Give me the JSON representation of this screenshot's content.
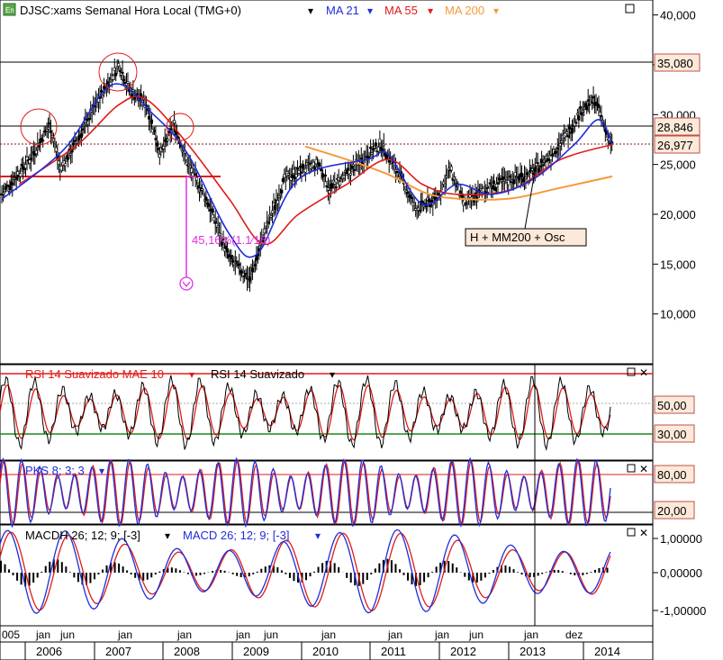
{
  "colors": {
    "ma21": "#1e2dd8",
    "ma55": "#e01b1b",
    "ma200": "#f59a3a",
    "rsi": "#000000",
    "rsi_ma": "#e01b1b",
    "stoch_k": "#1e2dd8",
    "stoch_d": "#e01b1b",
    "macd": "#1e2dd8",
    "macd_signal": "#e01b1b",
    "hist": "#000000",
    "annotation_magenta": "#e22fe2",
    "price_label_bg": "#fde9d9",
    "price_label_border": "#c0504d"
  },
  "header": {
    "icon": "chart-app-icon",
    "title": "DJSC:xams Semanal Hora Local (TMG+0)",
    "ma21": "MA 21",
    "ma55": "MA 55",
    "ma200": "MA 200"
  },
  "annotations": {
    "drop_pct": "45,16%(1.1⁄18)",
    "callout": "H + MM200 + Osc"
  },
  "price_labels": [
    "35,080",
    "28,846",
    "26,977"
  ],
  "rsi_panel": {
    "title_a": "RSI 14 Suavizado MAE 10",
    "title_b": "RSI 14 Suavizado",
    "levels": [
      "50,00",
      "30,00"
    ]
  },
  "stoch_panel": {
    "title": "PKS 8; 3; 3",
    "levels": [
      "80,00",
      "20,00"
    ]
  },
  "macd_panel": {
    "title_a": "MACDH 26; 12; 9; [-3]",
    "title_b": "MACD 26; 12; 9; [-3]"
  },
  "xaxis": {
    "months": [
      "005",
      "jan",
      "jun",
      "jan",
      "jan",
      "jan",
      "jun",
      "jan",
      "jan",
      "jan",
      "jun",
      "jan",
      "dez"
    ],
    "years": [
      "2006",
      "2007",
      "2008",
      "2009",
      "2010",
      "2011",
      "2012",
      "2013",
      "2014"
    ]
  },
  "chart_data": [
    {
      "type": "candlestick-line",
      "title": "DJSC:xams Semanal Hora Local (TMG+0)",
      "x_range": [
        "2005",
        "2014"
      ],
      "ylim": [
        5000,
        41500
      ],
      "yticks": [
        "10,000",
        "15,000",
        "20,000",
        "25,000",
        "30,000",
        "35,000",
        "40,000"
      ],
      "price_path": [
        [
          "2005.6",
          22000
        ],
        [
          "2006.0",
          25500
        ],
        [
          "2006.3",
          29000
        ],
        [
          "2006.45",
          24500
        ],
        [
          "2006.7",
          27500
        ],
        [
          "2007.0",
          31500
        ],
        [
          "2007.3",
          35000
        ],
        [
          "2007.45",
          32500
        ],
        [
          "2007.7",
          31000
        ],
        [
          "2007.9",
          26000
        ],
        [
          "2008.1",
          29000
        ],
        [
          "2008.3",
          25000
        ],
        [
          "2008.6",
          21000
        ],
        [
          "2008.9",
          15500
        ],
        [
          "2009.2",
          13500
        ],
        [
          "2009.4",
          18000
        ],
        [
          "2009.7",
          23500
        ],
        [
          "2009.95",
          24500
        ],
        [
          "2010.2",
          25000
        ],
        [
          "2010.35",
          22500
        ],
        [
          "2010.6",
          24000
        ],
        [
          "2010.9",
          26000
        ],
        [
          "2011.1",
          27000
        ],
        [
          "2011.4",
          23500
        ],
        [
          "2011.6",
          20500
        ],
        [
          "2011.9",
          21500
        ],
        [
          "2012.1",
          24500
        ],
        [
          "2012.3",
          21000
        ],
        [
          "2012.6",
          22500
        ],
        [
          "2012.95",
          23500
        ],
        [
          "2013.25",
          24000
        ],
        [
          "2013.5",
          25500
        ],
        [
          "2013.8",
          28000
        ],
        [
          "2014.0",
          30500
        ],
        [
          "2014.2",
          31500
        ],
        [
          "2014.35",
          28500
        ],
        [
          "2014.45",
          26900
        ]
      ],
      "series": [
        {
          "name": "MA 21",
          "values": [
            [
              2005.6,
              21500
            ],
            [
              2006.5,
              26500
            ],
            [
              2007.2,
              33000
            ],
            [
              2007.8,
              30000
            ],
            [
              2008.3,
              26000
            ],
            [
              2008.9,
              18000
            ],
            [
              2009.3,
              16000
            ],
            [
              2009.9,
              23500
            ],
            [
              2010.9,
              25500
            ],
            [
              2011.2,
              26000
            ],
            [
              2011.7,
              21000
            ],
            [
              2012.2,
              23000
            ],
            [
              2012.7,
              22000
            ],
            [
              2013.3,
              23500
            ],
            [
              2013.9,
              27000
            ],
            [
              2014.25,
              29500
            ],
            [
              2014.45,
              27000
            ]
          ]
        },
        {
          "name": "MA 55",
          "values": [
            [
              2005.85,
              23000
            ],
            [
              2006.7,
              27000
            ],
            [
              2007.3,
              31000
            ],
            [
              2007.7,
              31500
            ],
            [
              2008.3,
              27000
            ],
            [
              2008.9,
              21500
            ],
            [
              2009.4,
              17000
            ],
            [
              2009.9,
              20000
            ],
            [
              2010.6,
              23000
            ],
            [
              2011.2,
              25500
            ],
            [
              2011.7,
              23000
            ],
            [
              2012.2,
              22000
            ],
            [
              2013.0,
              22500
            ],
            [
              2013.7,
              25500
            ],
            [
              2014.45,
              27000
            ]
          ]
        },
        {
          "name": "MA 200",
          "values": [
            [
              2010.0,
              26800
            ],
            [
              2010.6,
              25500
            ],
            [
              2011.2,
              24000
            ],
            [
              2011.8,
              22000
            ],
            [
              2012.4,
              21500
            ],
            [
              2013.0,
              21600
            ],
            [
              2013.6,
              22500
            ],
            [
              2014.45,
              23800
            ]
          ]
        }
      ],
      "hlines": [
        35080,
        28846,
        26977,
        23900
      ]
    },
    {
      "type": "line",
      "title": "RSI 14 Suavizado MAE 10",
      "ylim": [
        20,
        85
      ],
      "levels": [
        80,
        30
      ],
      "series": [
        {
          "name": "RSI 14 Suavizado"
        },
        {
          "name": "RSI 14 Suavizado MAE 10"
        }
      ]
    },
    {
      "type": "line",
      "title": "PKS 8; 3; 3",
      "ylim": [
        0,
        100
      ],
      "levels": [
        80,
        20
      ]
    },
    {
      "type": "bar-line",
      "title": "MACD 26; 12; 9; [-3]",
      "ylim": [
        -1.25,
        1.25
      ],
      "yticks": [
        "1,00000",
        "0,00000",
        "-1,00000"
      ]
    }
  ]
}
